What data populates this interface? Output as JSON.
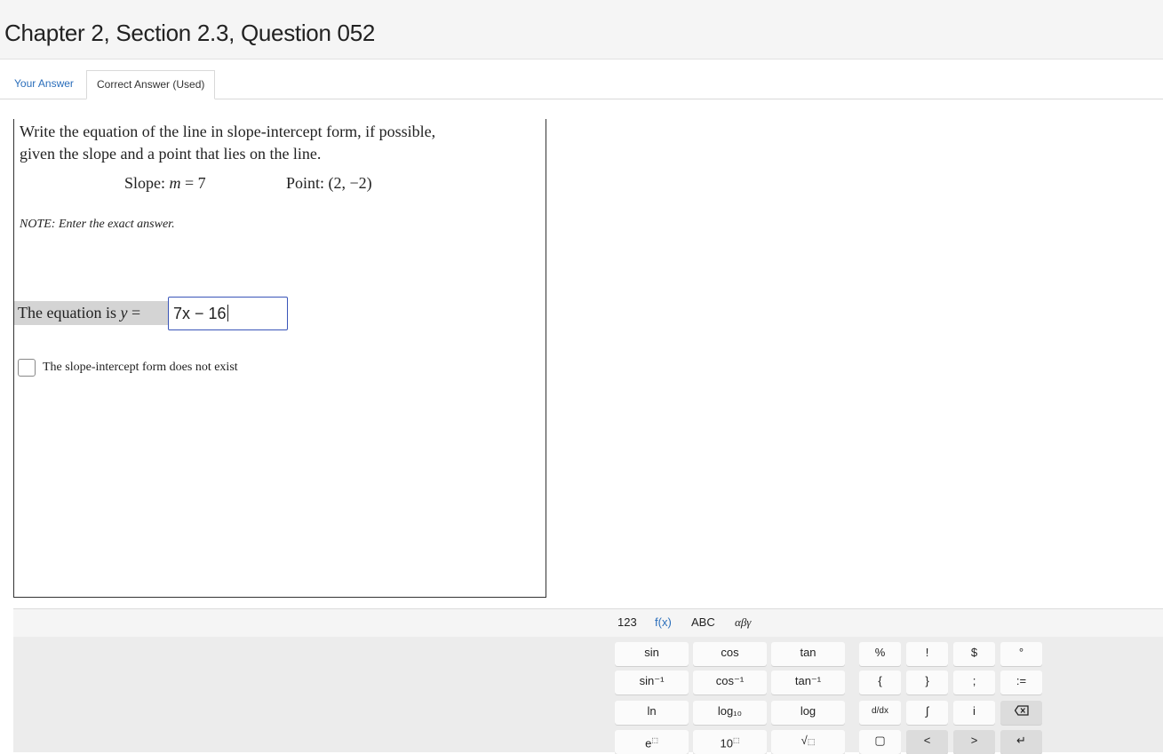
{
  "header": {
    "title": "Chapter 2, Section 2.3, Question 052"
  },
  "tabs": [
    {
      "label": "Your Answer"
    },
    {
      "label": "Correct Answer (Used)"
    }
  ],
  "question": {
    "prompt_line1": "Write the equation of the line in slope-intercept form, if possible,",
    "prompt_line2": "given the slope and a point that lies on the line.",
    "slope_label": "Slope: ",
    "slope_var": "m",
    "slope_value": " = 7",
    "point_label": "Point: ",
    "point_value": "(2, −2)",
    "note": "NOTE: Enter the exact answer.",
    "equation_label": "The equation is ",
    "equation_var": "y",
    "equation_eq": " =",
    "answer_value": "7x − 16",
    "checkbox_label": "The slope-intercept form does not exist"
  },
  "keyboard": {
    "tabs": [
      "123",
      "f(x)",
      "ABC",
      "αβγ"
    ],
    "active_tab": "f(x)",
    "rows": [
      [
        "sin",
        "cos",
        "tan",
        "%",
        "!",
        "$",
        "°"
      ],
      [
        "sin⁻¹",
        "cos⁻¹",
        "tan⁻¹",
        "{",
        "}",
        ";",
        ":="
      ],
      [
        "ln",
        "log₁₀",
        "log",
        "d/dx",
        "∫",
        "i",
        "⌫"
      ],
      [
        "e",
        "10",
        "√",
        "▢",
        "<",
        ">",
        "↵"
      ]
    ]
  }
}
